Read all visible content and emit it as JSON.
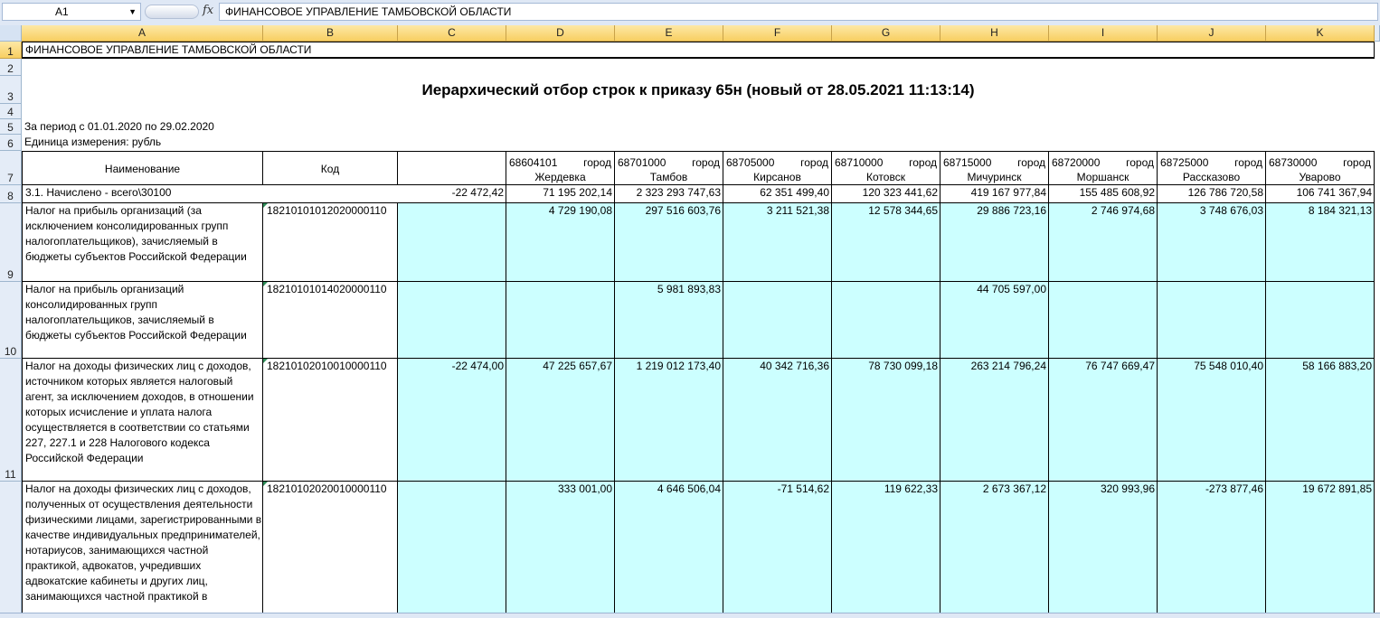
{
  "formula_bar": {
    "name_box": "A1",
    "fx_label": "fx",
    "content": "ФИНАНСОВОЕ УПРАВЛЕНИЕ ТАМБОВСКОЙ ОБЛАСТИ"
  },
  "columns": [
    "A",
    "B",
    "C",
    "D",
    "E",
    "F",
    "G",
    "H",
    "I",
    "J",
    "K"
  ],
  "rows_numbers": [
    "1",
    "2",
    "3",
    "4",
    "5",
    "6",
    "7",
    "8",
    "9",
    "10",
    "11",
    ""
  ],
  "sheet": {
    "org": "ФИНАНСОВОЕ УПРАВЛЕНИЕ ТАМБОВСКОЙ ОБЛАСТИ",
    "title": "Иерархический отбор строк к приказу 65н (новый от 28.05.2021 11:13:14)",
    "period": "За период с 01.01.2020 по 29.02.2020",
    "unit": "Единица измерения: рубль",
    "header": {
      "name": "Наименование",
      "code": "Код",
      "cities": [
        {
          "code": "68604101",
          "kind": "город",
          "name": "Жердевка"
        },
        {
          "code": "68701000",
          "kind": "город",
          "name": "Тамбов"
        },
        {
          "code": "68705000",
          "kind": "город",
          "name": "Кирсанов"
        },
        {
          "code": "68710000",
          "kind": "город",
          "name": "Котовск"
        },
        {
          "code": "68715000",
          "kind": "город",
          "name": "Мичуринск"
        },
        {
          "code": "68720000",
          "kind": "город",
          "name": "Моршанск"
        },
        {
          "code": "68725000",
          "kind": "город",
          "name": "Рассказово"
        },
        {
          "code": "68730000",
          "kind": "город",
          "name": "Уварово"
        }
      ]
    },
    "total_row": {
      "label": "3.1. Начислено - всего\\30100",
      "c": "-22 472,42",
      "values": [
        "71 195 202,14",
        "2 323 293 747,63",
        "62 351 499,40",
        "120 323 441,62",
        "419 167 977,84",
        "155 485 608,92",
        "126 786 720,58",
        "106 741 367,94"
      ]
    },
    "rows": [
      {
        "name": "Налог на прибыль организаций (за исключением консолидированных групп налогоплательщиков), зачисляемый в бюджеты субъектов Российской Федерации",
        "code": "18210101012020000110",
        "c": "",
        "values": [
          "4 729 190,08",
          "297 516 603,76",
          "3 211 521,38",
          "12 578 344,65",
          "29 886 723,16",
          "2 746 974,68",
          "3 748 676,03",
          "8 184 321,13"
        ]
      },
      {
        "name": "Налог на прибыль организаций консолидированных групп налогоплательщиков, зачисляемый в бюджеты субъектов Российской Федерации",
        "code": "18210101014020000110",
        "c": "",
        "values": [
          "",
          "5 981 893,83",
          "",
          "",
          "44 705 597,00",
          "",
          "",
          ""
        ]
      },
      {
        "name": "Налог на доходы физических лиц с доходов, источником которых является налоговый агент, за исключением доходов, в отношении которых исчисление и уплата налога осуществляется в соответствии со статьями 227, 227.1 и 228 Налогового кодекса Российской Федерации",
        "code": "18210102010010000110",
        "c": "-22 474,00",
        "values": [
          "47 225 657,67",
          "1 219 012 173,40",
          "40 342 716,36",
          "78 730 099,18",
          "263 214 796,24",
          "76 747 669,47",
          "75 548 010,40",
          "58 166 883,20"
        ]
      },
      {
        "name": "Налог на доходы физических лиц с доходов, полученных от осуществления деятельности физическими лицами, зарегистрированными в качестве индивидуальных предпринимателей, нотариусов, занимающихся частной практикой, адвокатов, учредивших адвокатские кабинеты и других лиц, занимающихся частной практикой в",
        "code": "18210102020010000110",
        "c": "",
        "values": [
          "333 001,00",
          "4 646 506,04",
          "-71 514,62",
          "119 622,33",
          "2 673 367,12",
          "320 993,96",
          "-273 877,46",
          "19 672 891,85"
        ]
      }
    ]
  }
}
